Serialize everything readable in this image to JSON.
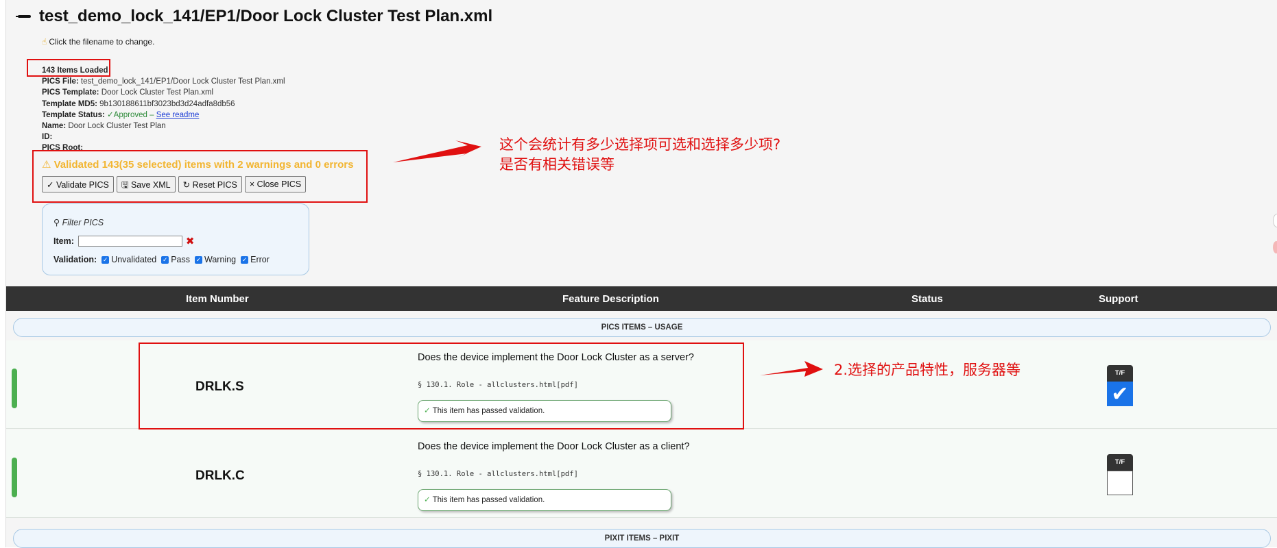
{
  "header": {
    "title": "test_demo_lock_141/EP1/Door Lock Cluster Test Plan.xml",
    "hint": "Click the filename to change."
  },
  "meta": {
    "items_loaded": "143 Items Loaded",
    "pics_file_label": "PICS File:",
    "pics_file_value": "test_demo_lock_141/EP1/Door Lock Cluster Test Plan.xml",
    "pics_template_label": "PICS Template:",
    "pics_template_value": "Door Lock Cluster Test Plan.xml",
    "template_md5_label": "Template MD5:",
    "template_md5_value": "9b130188611bf3023bd3d24adfa8db56",
    "template_status_label": "Template Status:",
    "template_status_value": "✓Approved –",
    "see_readme": "See readme",
    "name_label": "Name:",
    "name_value": "Door Lock Cluster Test Plan",
    "id_label": "ID:",
    "pics_root_label": "PICS Root:"
  },
  "validation": {
    "summary": "⚠ Validated 143(35 selected) items with 2 warnings and 0 errors",
    "color": "#f2b531"
  },
  "toolbar": {
    "validate": "✓ Validate PICS",
    "save": "🖫 Save XML",
    "reset": "↻ Reset PICS",
    "close": "× Close PICS"
  },
  "filter": {
    "title": "Filter PICS",
    "item_label": "Item:",
    "item_value": "",
    "validation_label": "Validation:",
    "options": [
      "Unvalidated",
      "Pass",
      "Warning",
      "Error"
    ]
  },
  "table": {
    "headers": [
      "Item Number",
      "Feature Description",
      "Status",
      "Support"
    ],
    "sections": [
      "PICS ITEMS – USAGE",
      "PIXIT ITEMS – PIXIT"
    ],
    "rows": [
      {
        "item": "DRLK.S",
        "description": "Does the device implement the Door Lock Cluster as a server?",
        "reference": "§ 130.1. Role - allclusters.html[pdf]",
        "status": "This item has passed validation.",
        "tf_label": "T/F",
        "checked": true
      },
      {
        "item": "DRLK.C",
        "description": "Does the device implement the Door Lock Cluster as a client?",
        "reference": "§ 130.1. Role - allclusters.html[pdf]",
        "status": "This item has passed validation.",
        "tf_label": "T/F",
        "checked": false
      }
    ]
  },
  "annotations": {
    "note1_line1": "这个会统计有多少选择项可选和选择多少项?",
    "note1_line2": "是否有相关错误等",
    "note2": "2.选择的产品特性，服务器等",
    "color": "#e01010"
  }
}
